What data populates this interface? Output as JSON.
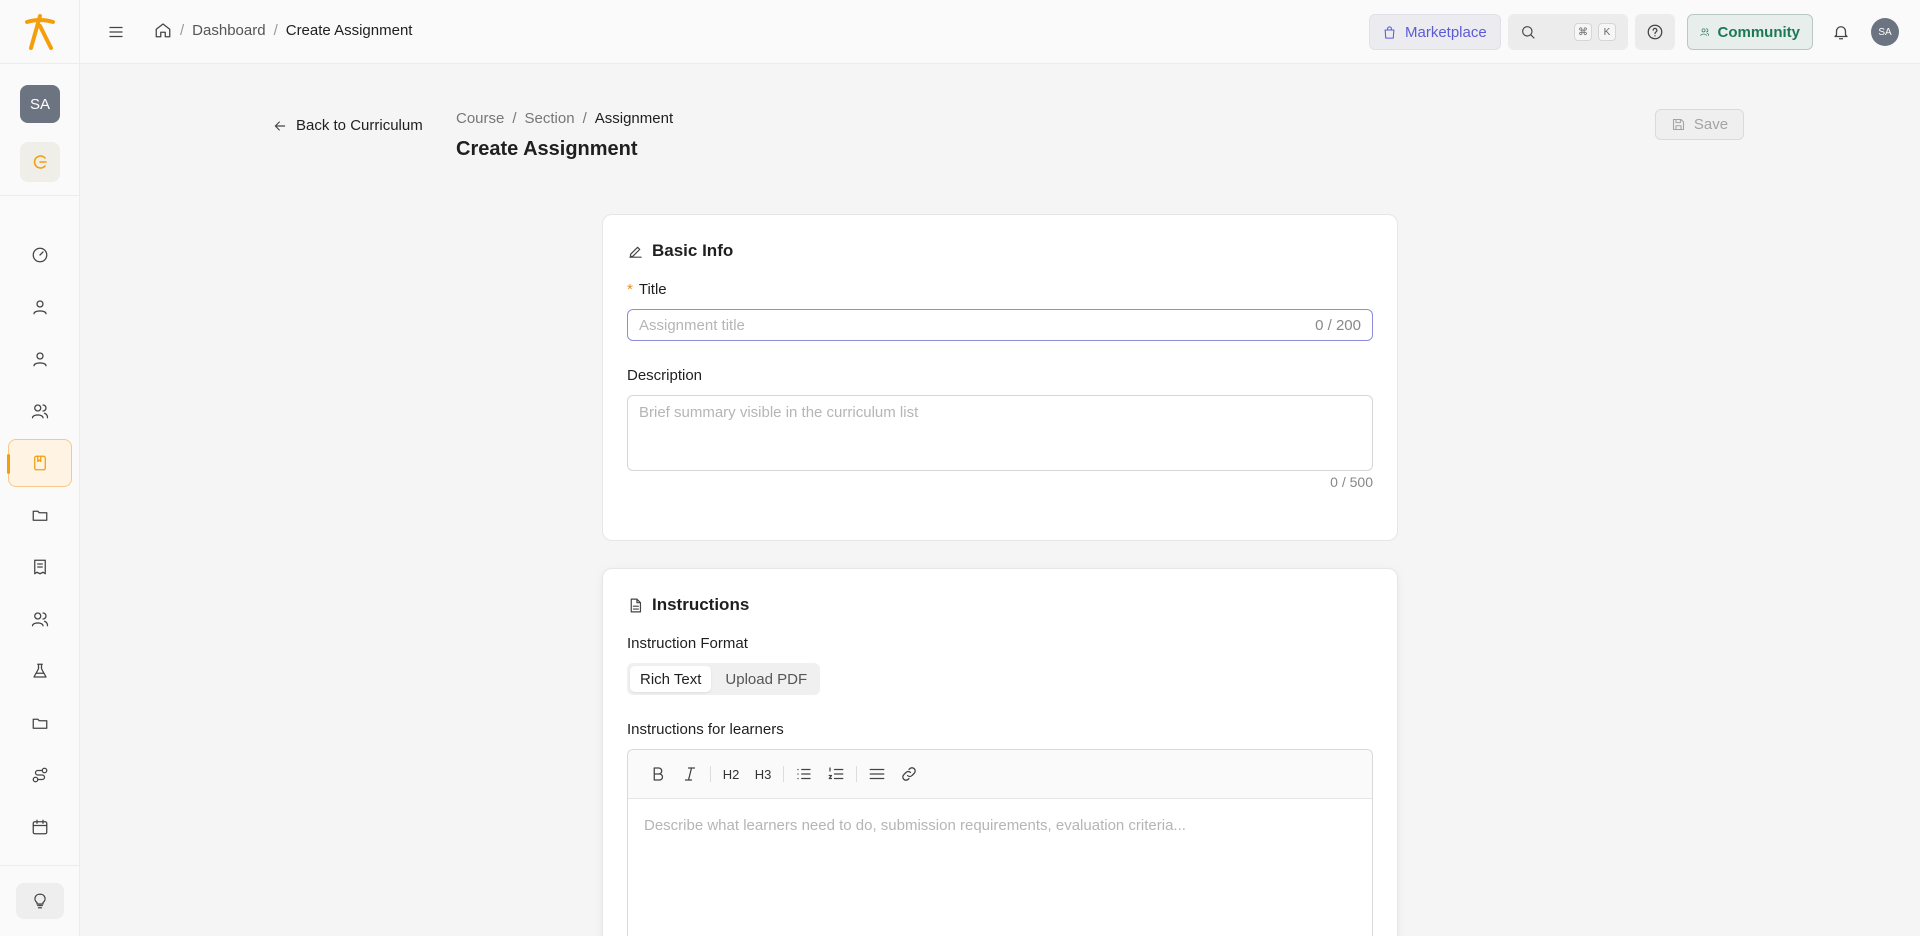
{
  "topbar": {
    "breadcrumb": {
      "dashboard": "Dashboard",
      "current": "Create Assignment"
    },
    "marketplace_label": "Marketplace",
    "search_keys": [
      "⌘",
      "K"
    ],
    "community_label": "Community",
    "avatar_initials": "SA"
  },
  "sidebar": {
    "avatar_initials": "SA",
    "items": [
      "dashboard-icon",
      "user-icon",
      "user-icon",
      "users-icon",
      "book-icon",
      "folder-icon",
      "receipt-icon",
      "users-icon",
      "flask-icon",
      "folder-icon",
      "route-icon",
      "calendar-icon"
    ],
    "active_item": "book-icon",
    "bulb_icon": "lightbulb-icon"
  },
  "header": {
    "back_label": "Back to Curriculum",
    "crumbs": [
      "Course",
      "Section",
      "Assignment"
    ],
    "title": "Create Assignment",
    "save_label": "Save"
  },
  "basic_info": {
    "heading": "Basic Info",
    "title_label": "Title",
    "title_placeholder": "Assignment title",
    "title_counter": "0 / 200",
    "description_label": "Description",
    "description_placeholder": "Brief summary visible in the curriculum list",
    "description_counter": "0 / 500"
  },
  "instructions": {
    "heading": "Instructions",
    "format_label": "Instruction Format",
    "format_options": [
      "Rich Text",
      "Upload PDF"
    ],
    "format_selected": "Rich Text",
    "learners_label": "Instructions for learners",
    "toolbar": {
      "h2": "H2",
      "h3": "H3"
    },
    "editor_placeholder": "Describe what learners need to do, submission requirements, evaluation criteria..."
  },
  "colors": {
    "accent": "#f59e0b",
    "brand_purple": "#5b5bd6",
    "community_green": "#1b7a55"
  }
}
